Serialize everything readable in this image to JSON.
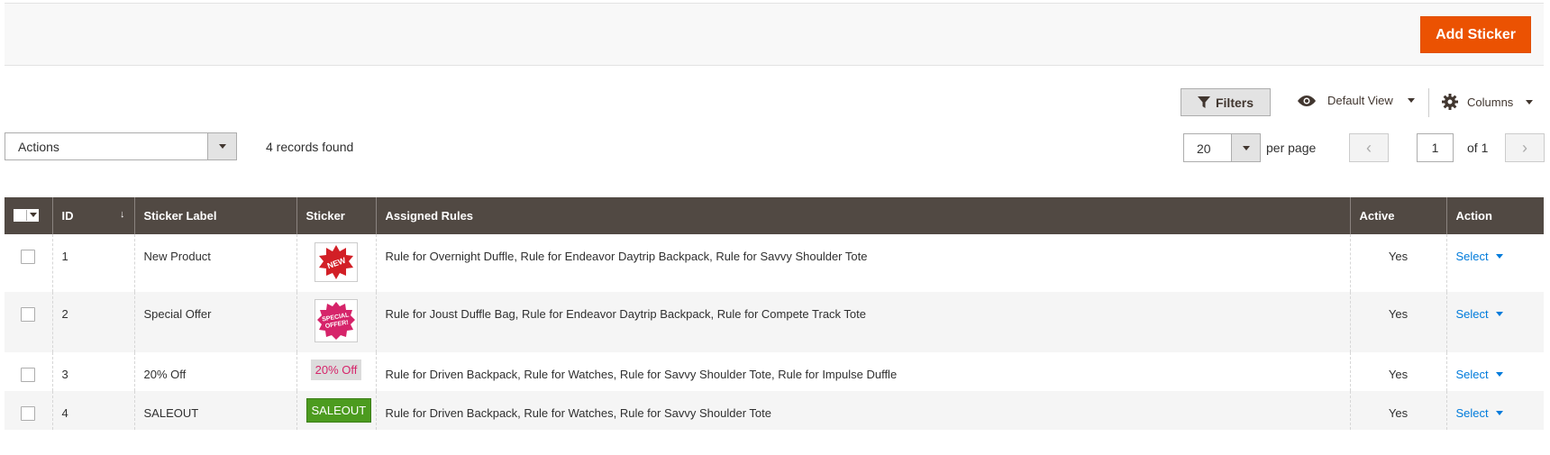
{
  "header": {
    "add_button": "Add Sticker"
  },
  "toolbar": {
    "filters_label": "Filters",
    "view_label": "Default View",
    "columns_label": "Columns",
    "actions_label": "Actions",
    "records_found": "4 records found",
    "per_page_value": "20",
    "per_page_label": "per page",
    "current_page": "1",
    "of_pages": "of 1"
  },
  "grid": {
    "columns": [
      "ID",
      "Sticker Label",
      "Sticker",
      "Assigned Rules",
      "Active",
      "Action"
    ],
    "rows": [
      {
        "id": "1",
        "label": "New Product",
        "sticker": {
          "kind": "image",
          "icon": "new-starburst-icon",
          "text": "NEW",
          "color": "#d21f26"
        },
        "rules": "Rule for Overnight Duffle, Rule for Endeavor Daytrip Backpack, Rule for Savvy Shoulder Tote",
        "active": "Yes",
        "action": "Select"
      },
      {
        "id": "2",
        "label": "Special Offer",
        "sticker": {
          "kind": "image",
          "icon": "special-offer-starburst-icon",
          "text": "SPECIAL OFFER!",
          "color": "#d6246a"
        },
        "rules": "Rule for Joust Duffle Bag, Rule for Endeavor Daytrip Backpack, Rule for Compete Track Tote",
        "active": "Yes",
        "action": "Select"
      },
      {
        "id": "3",
        "label": "20% Off",
        "sticker": {
          "kind": "text",
          "text": "20% Off",
          "color": "#d6246a"
        },
        "rules": "Rule for Driven Backpack, Rule for Watches, Rule for Savvy Shoulder Tote, Rule for Impulse Duffle",
        "active": "Yes",
        "action": "Select"
      },
      {
        "id": "4",
        "label": "SALEOUT",
        "sticker": {
          "kind": "text",
          "text": "SALEOUT",
          "color": "#4c9b1f"
        },
        "rules": "Rule for Driven Backpack, Rule for Watches, Rule for Savvy Shoulder Tote",
        "active": "Yes",
        "action": "Select"
      }
    ]
  },
  "colors": {
    "accent": "#eb5202",
    "header_bg": "#514943",
    "link": "#007bdb"
  }
}
